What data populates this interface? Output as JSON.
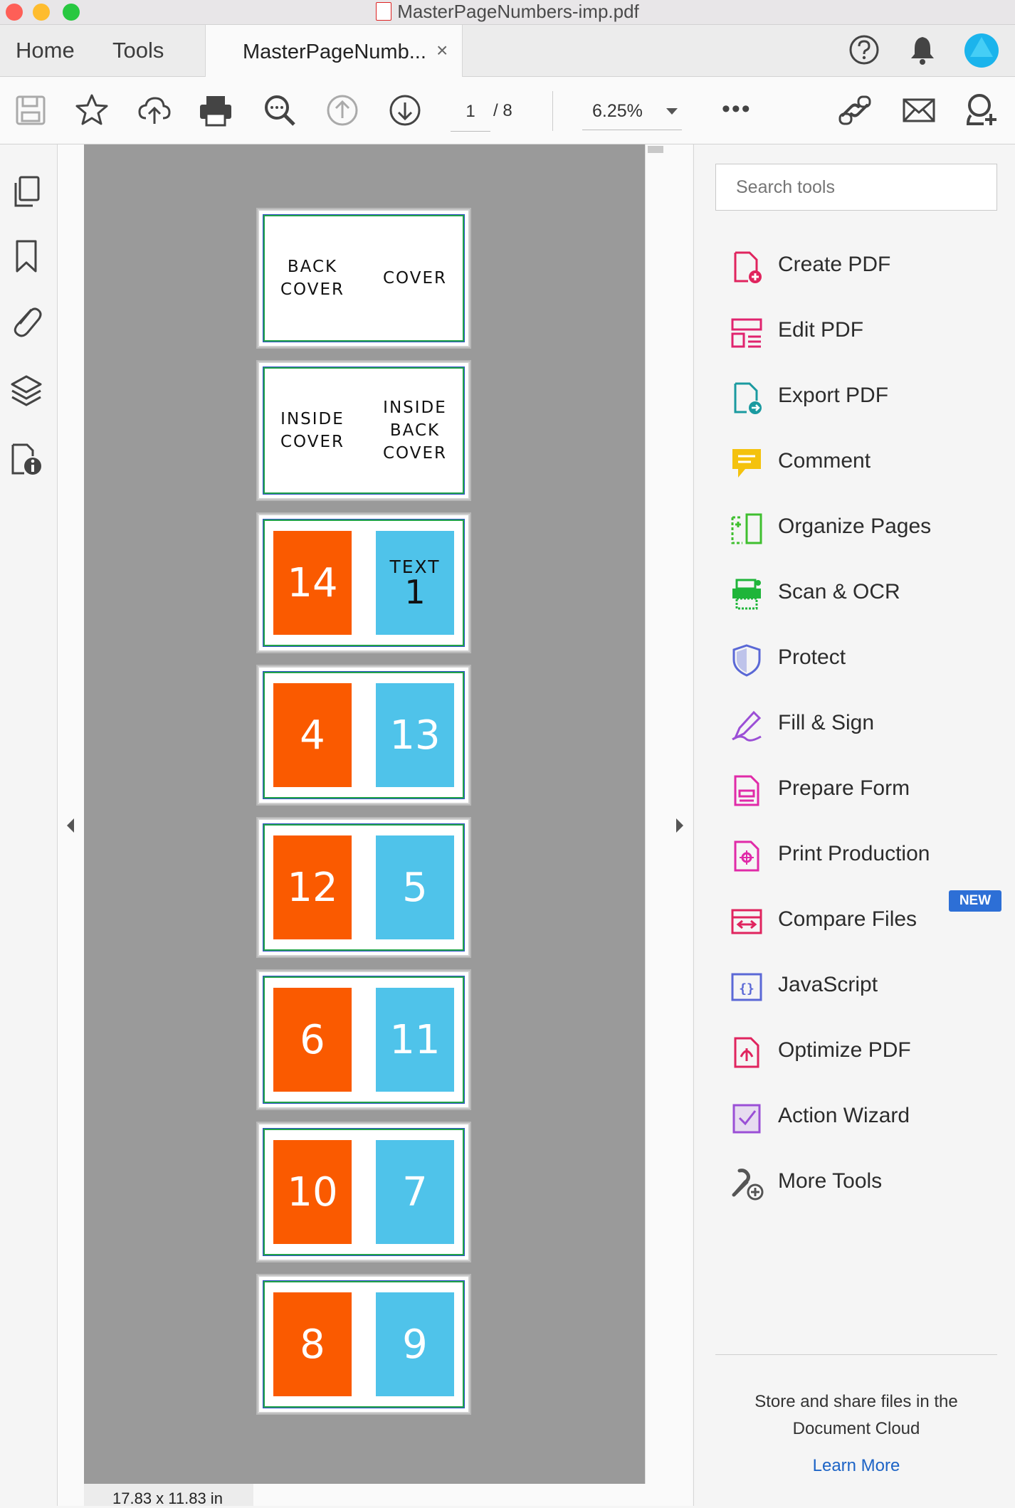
{
  "window": {
    "title": "MasterPageNumbers-imp.pdf",
    "colors": {
      "close": "#fe5f57",
      "minimize": "#febc2e",
      "zoom": "#28c840"
    }
  },
  "tabs": {
    "home": "Home",
    "tools": "Tools",
    "document": "MasterPageNumb...",
    "close": "×"
  },
  "toolbar": {
    "page_current": "1",
    "page_total": "/ 8",
    "zoom": "6.25%",
    "more": "•••"
  },
  "status": {
    "dimensions": "17.83 x 11.83 in"
  },
  "spreads": [
    {
      "left": {
        "kind": "text",
        "text": "BACK\nCOVER"
      },
      "right": {
        "kind": "text",
        "text": "COVER"
      }
    },
    {
      "left": {
        "kind": "text",
        "text": "INSIDE\nCOVER"
      },
      "right": {
        "kind": "text",
        "text": "INSIDE\nBACK\nCOVER"
      }
    },
    {
      "left": {
        "kind": "orange",
        "text": "14"
      },
      "right": {
        "kind": "bluetext",
        "small": "TEXT",
        "big": "1"
      }
    },
    {
      "left": {
        "kind": "orange",
        "text": "4"
      },
      "right": {
        "kind": "blue",
        "text": "13"
      }
    },
    {
      "left": {
        "kind": "orange",
        "text": "12"
      },
      "right": {
        "kind": "blue",
        "text": "5"
      }
    },
    {
      "left": {
        "kind": "orange",
        "text": "6"
      },
      "right": {
        "kind": "blue",
        "text": "11"
      }
    },
    {
      "left": {
        "kind": "orange",
        "text": "10"
      },
      "right": {
        "kind": "blue",
        "text": "7"
      }
    },
    {
      "left": {
        "kind": "orange",
        "text": "8"
      },
      "right": {
        "kind": "blue",
        "text": "9"
      }
    }
  ],
  "panel_colors": {
    "orange": "#fa5a00",
    "blue": "#4fc3ea"
  },
  "right_panel": {
    "search_placeholder": "Search tools",
    "tools": [
      {
        "label": "Create PDF",
        "icon": "create-pdf-icon",
        "color": "#e0245e"
      },
      {
        "label": "Edit PDF",
        "icon": "edit-pdf-icon",
        "color": "#e0246e"
      },
      {
        "label": "Export PDF",
        "icon": "export-pdf-icon",
        "color": "#1a9aa0"
      },
      {
        "label": "Comment",
        "icon": "comment-icon",
        "color": "#f4c20d"
      },
      {
        "label": "Organize Pages",
        "icon": "organize-pages-icon",
        "color": "#3fbf2f"
      },
      {
        "label": "Scan & OCR",
        "icon": "scan-ocr-icon",
        "color": "#1fb53a"
      },
      {
        "label": "Protect",
        "icon": "protect-icon",
        "color": "#5a68d6"
      },
      {
        "label": "Fill & Sign",
        "icon": "fill-sign-icon",
        "color": "#9b4fd6"
      },
      {
        "label": "Prepare Form",
        "icon": "prepare-form-icon",
        "color": "#e02aa8"
      },
      {
        "label": "Print Production",
        "icon": "print-production-icon",
        "color": "#e02aa8"
      },
      {
        "label": "Compare Files",
        "icon": "compare-files-icon",
        "color": "#e0245e"
      },
      {
        "label": "JavaScript",
        "icon": "javascript-icon",
        "color": "#5a68d6"
      },
      {
        "label": "Optimize PDF",
        "icon": "optimize-pdf-icon",
        "color": "#e0245e"
      },
      {
        "label": "Action Wizard",
        "icon": "action-wizard-icon",
        "color": "#9b4fd6"
      },
      {
        "label": "More Tools",
        "icon": "more-tools-icon",
        "color": "#555555"
      }
    ],
    "new_badge": "NEW",
    "cloud_text": "Store and share files in the\nDocument Cloud",
    "learn_more": "Learn More"
  }
}
